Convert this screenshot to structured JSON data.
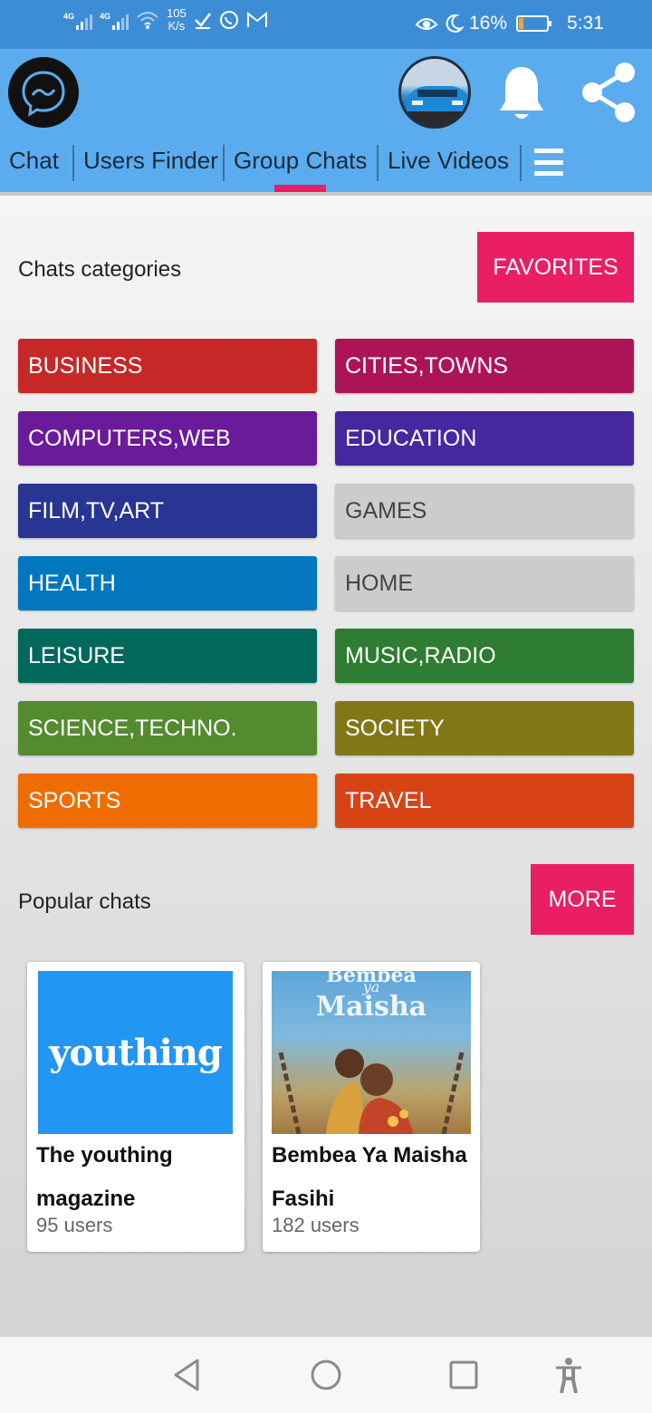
{
  "status_bar": {
    "signal1_label": "4G",
    "signal2_label": "4G",
    "speed_value": "105",
    "speed_unit": "K/s",
    "battery_percent": "16%",
    "battery_level": 0.16,
    "time": "5:31"
  },
  "header": {
    "logo_icon": "messenger-chat-icon",
    "avatar_icon": "profile-avatar",
    "bell_icon": "bell-icon",
    "share_icon": "share-icon"
  },
  "tabs": [
    {
      "label": "Chat"
    },
    {
      "label": "Users Finder"
    },
    {
      "label": "Group Chats"
    },
    {
      "label": "Live Videos"
    }
  ],
  "active_tab": "Group Chats",
  "categories_section": {
    "title": "Chats categories",
    "favorites_label": "FAVORITES",
    "items": [
      {
        "label": "BUSINESS",
        "color": "#c62828"
      },
      {
        "label": "CITIES,TOWNS",
        "color": "#ad1457"
      },
      {
        "label": "COMPUTERS,WEB",
        "color": "#6a1b9a"
      },
      {
        "label": "EDUCATION",
        "color": "#4527a0"
      },
      {
        "label": "FILM,TV,ART",
        "color": "#283593"
      },
      {
        "label": "GAMES",
        "color": "#cccccc"
      },
      {
        "label": "HEALTH",
        "color": "#0277bd"
      },
      {
        "label": "HOME",
        "color": "#cccccc"
      },
      {
        "label": "LEISURE",
        "color": "#00695c"
      },
      {
        "label": "MUSIC,RADIO",
        "color": "#2e7d32"
      },
      {
        "label": "SCIENCE,TECHNO.",
        "color": "#558b2f"
      },
      {
        "label": "SOCIETY",
        "color": "#827717"
      },
      {
        "label": "SPORTS",
        "color": "#ef6c00"
      },
      {
        "label": "TRAVEL",
        "color": "#d84315"
      }
    ]
  },
  "popular_section": {
    "title": "Popular chats",
    "more_label": "MORE",
    "cards": [
      {
        "image_text": "youthing",
        "title": "The youthing magazine",
        "users": "95 users"
      },
      {
        "image_text_top": "Bembea",
        "image_text_mid": "ya",
        "image_text_bottom": "Maisha",
        "title": "Bembea Ya Maisha Fasihi",
        "users": "182 users"
      }
    ]
  },
  "nav": {
    "back_icon": "back-triangle-icon",
    "home_icon": "home-circle-icon",
    "recents_icon": "recents-square-icon",
    "accessibility_icon": "accessibility-icon"
  }
}
